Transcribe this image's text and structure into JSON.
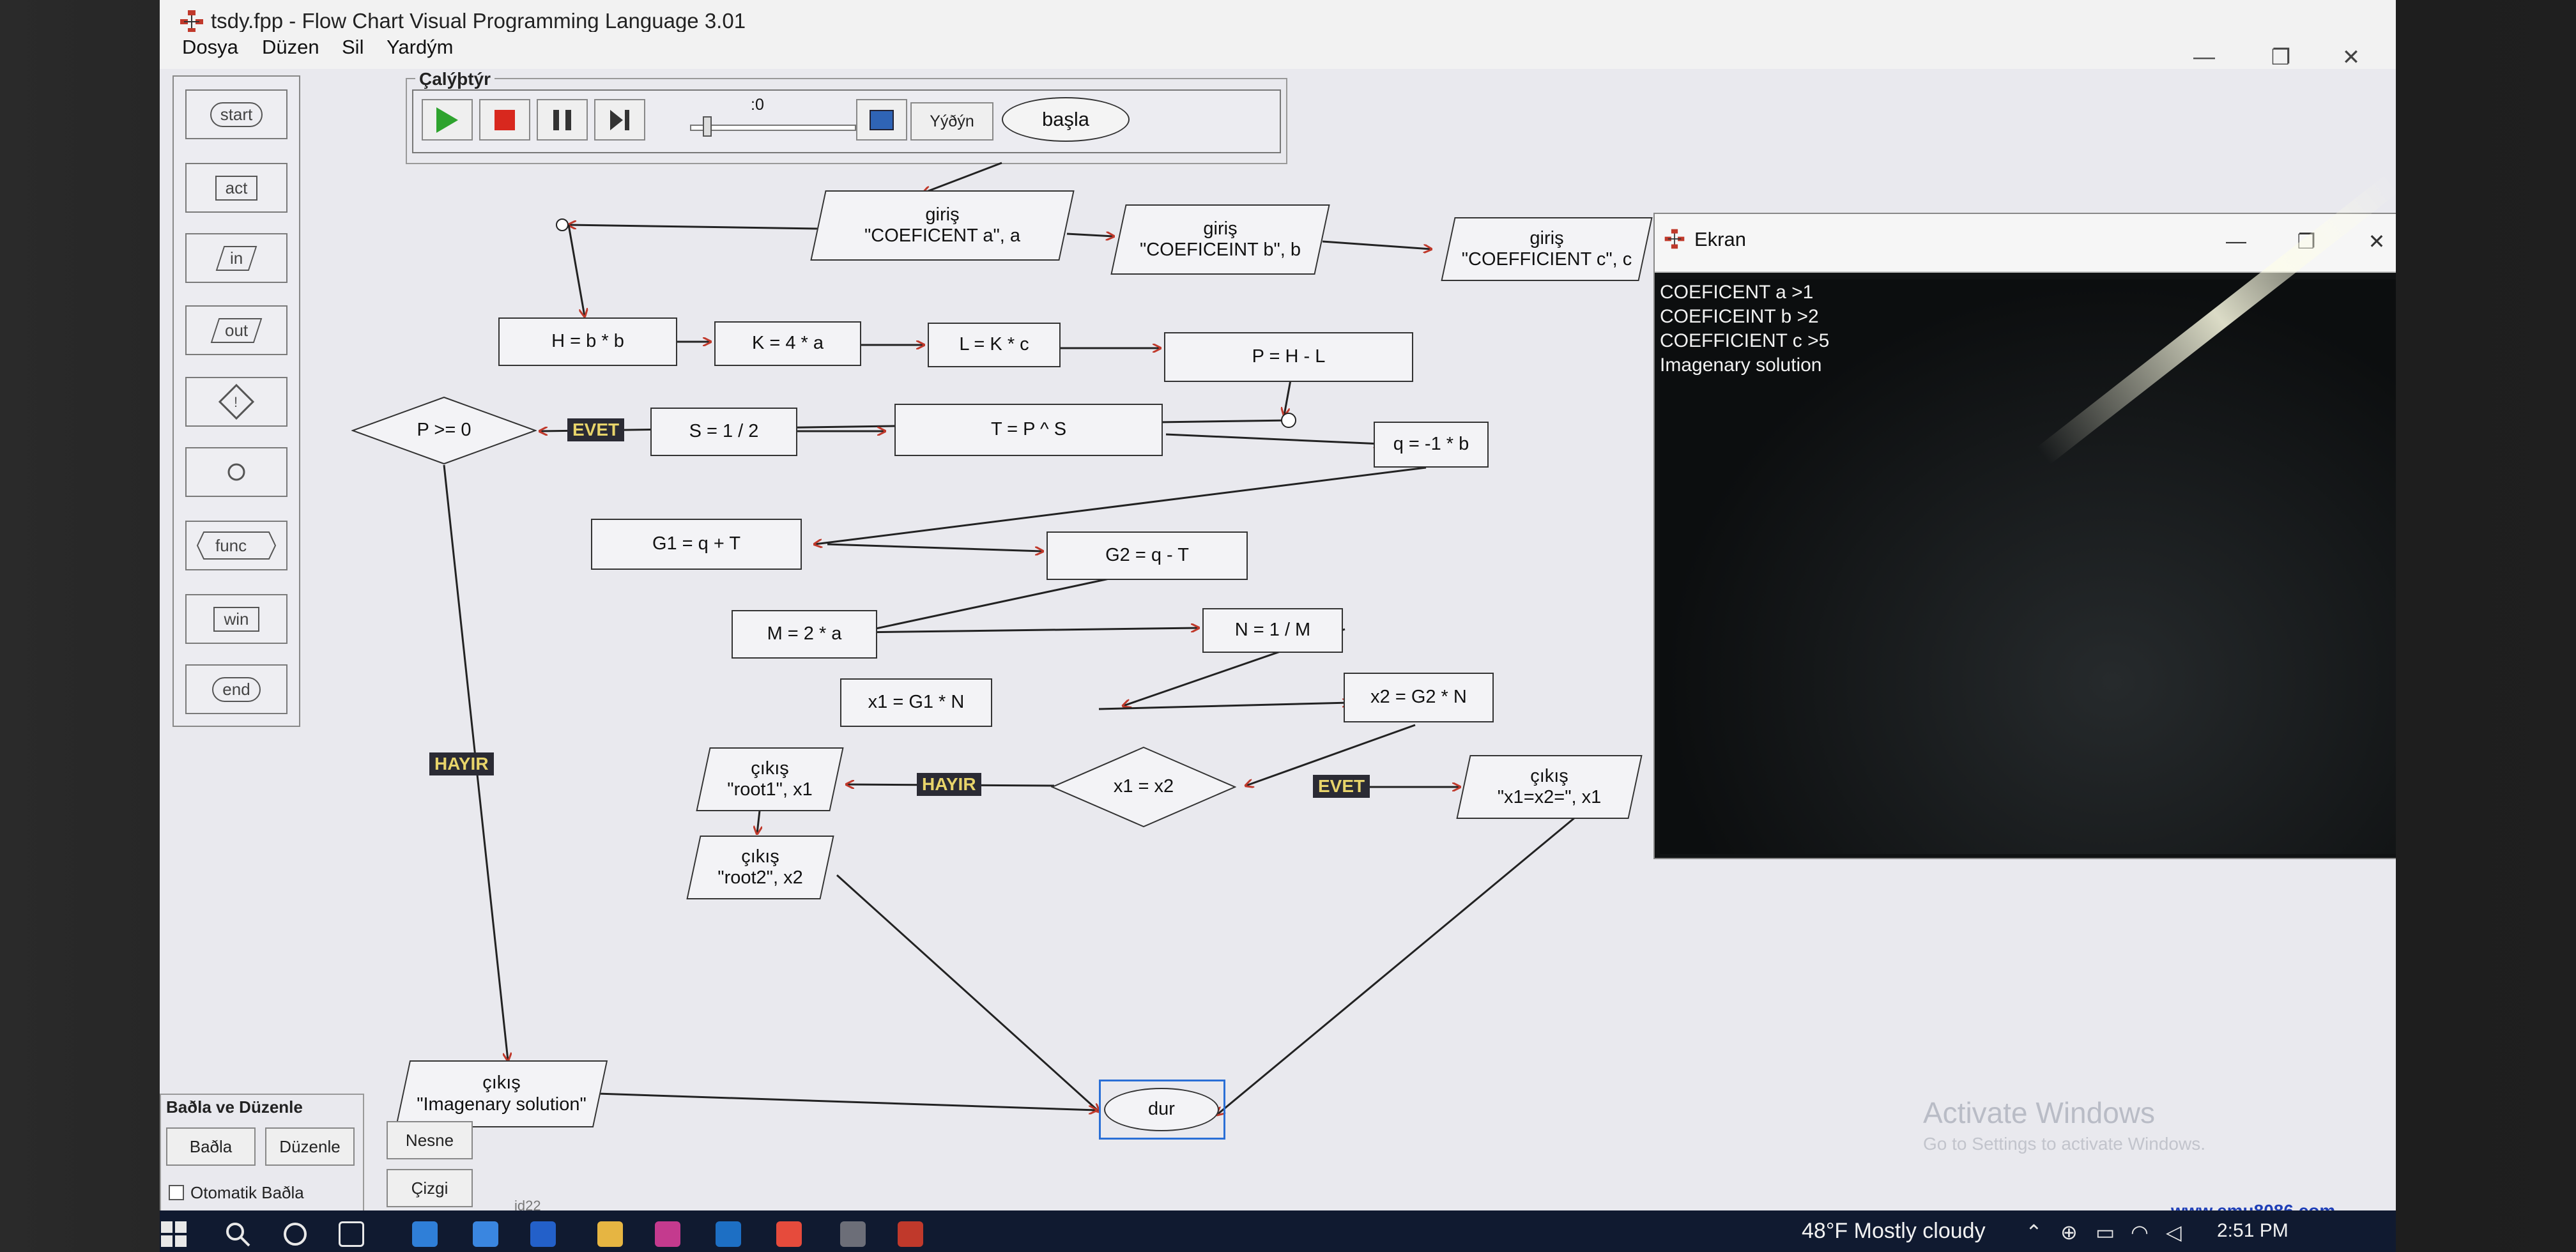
{
  "window": {
    "title": "tsdy.fpp - Flow Chart Visual Programming Language 3.01",
    "minimize": "—",
    "restore": "❐",
    "close": "✕"
  },
  "menu": [
    "Dosya",
    "Düzen",
    "Sil",
    "Yardým"
  ],
  "palette": [
    "start",
    "act",
    "in",
    "out",
    "func",
    "win",
    "end"
  ],
  "run_panel": {
    "legend": "Çalýþtýr",
    "speed_value": ":0",
    "spread_label": "Yýðýn",
    "start_label": "başla"
  },
  "flowchart": {
    "nodes": {
      "in_a": "giriş\n\"COEFICENT a\", a",
      "in_b": "giriş\n\"COEFICEINT b\", b",
      "in_c": "giriş\n\"COEFFICIENT c\", c",
      "h": "H = b * b",
      "k": "K = 4 * a",
      "l": "L = K * c",
      "p": "P = H - L",
      "cond_p": "P >= 0",
      "s": "S = 1 / 2",
      "t": "T = P ^ S",
      "q": "q = -1 * b",
      "g1": "G1 = q + T",
      "g2": "G2 = q - T",
      "m": "M = 2 * a",
      "n": "N = 1 / M",
      "x1": "x1 = G1 * N",
      "x2": "x2 = G2 * N",
      "cond_x": "x1 = x2",
      "out_root1": "çıkış\n\"root1\", x1",
      "out_root2": "çıkış\n\"root2\", x2",
      "out_equal": "çıkış\n\"x1=x2=\", x1",
      "out_imag": "çıkış\n\"Imagenary solution\"",
      "end": "dur"
    },
    "labels": {
      "yes_p": "EVET",
      "no_p": "HAYIR",
      "no_x": "HAYIR",
      "yes_x": "EVET"
    }
  },
  "link_panel": {
    "title": "Baðla ve Düzenle",
    "connect": "Baðla",
    "arrange": "Düzenle",
    "object": "Nesne",
    "line": "Çizgi",
    "auto_connect": "Otomatik Baðla"
  },
  "id_text": "id22",
  "output_window": {
    "title": "Ekran",
    "lines": [
      "COEFICENT a >1",
      "COEFICEINT b >2",
      "COEFFICIENT c >5",
      "Imagenary solution"
    ]
  },
  "watermark": {
    "line1": "Activate Windows",
    "line2": "Go to Settings to activate Windows.",
    "site": "www.emu8086.com"
  },
  "taskbar": {
    "weather": "48°F  Mostly cloudy",
    "time": "2:51 PM"
  },
  "colors": {
    "arrow_head": "#c0392b",
    "edge_label_bg": "#2b2b34",
    "edge_label_fg": "#e8d46a",
    "play": "#2ea32e",
    "stop": "#d8281e"
  }
}
